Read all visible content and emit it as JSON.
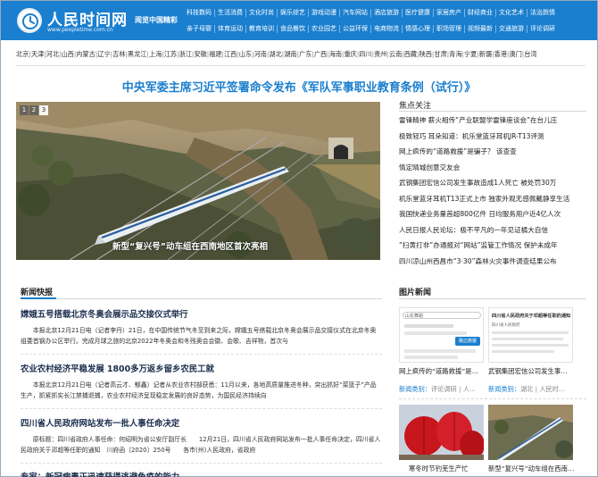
{
  "header": {
    "site_name": "人民时间网",
    "site_url": "www.peopletime.com.cn",
    "slogan": "阅览中国精彩",
    "nav_row1": [
      "科技数码",
      "生活消费",
      "文化时尚",
      "娱乐综艺",
      "游戏动漫",
      "汽车网站",
      "酒店旅游",
      "医疗健康",
      "家居房产",
      "财经商业",
      "文化艺术",
      "法治舆情"
    ],
    "nav_row2": [
      "亲子母婴",
      "体育运动",
      "教育培训",
      "食品餐饮",
      "农业园艺",
      "公益环保",
      "电商物流",
      "情感心理",
      "职场管理",
      "视频最新",
      "交通旅游",
      "评论调研"
    ]
  },
  "regions": [
    "北京",
    "天津",
    "河北",
    "山西",
    "内蒙古",
    "辽宁",
    "吉林",
    "黑龙江",
    "上海",
    "江苏",
    "浙江",
    "安徽",
    "福建",
    "江西",
    "山东",
    "河南",
    "湖北",
    "湖南",
    "广东",
    "广西",
    "海南",
    "重庆",
    "四川",
    "贵州",
    "云南",
    "西藏",
    "陕西",
    "甘肃",
    "青海",
    "宁夏",
    "新疆",
    "香港",
    "澳门",
    "台湾"
  ],
  "headline": "中央军委主席习近平签署命令发布《军队军事职业教育条例（试行）》",
  "slider": {
    "pages": [
      "1",
      "2",
      "3"
    ],
    "active_page": "3",
    "caption": "新型“复兴号”动车组在西南地区首次亮相"
  },
  "focus": {
    "title": "焦点关注",
    "items": [
      "雷锋精神 薪火相传“产业联盟学雷锋座谈会”在台儿庄",
      "极致轻巧 耳朵知道：机乐堂蓝牙耳机JR-T13评测",
      "网上疯传的“道路救援”是骗子？ 该查查",
      "情定晴城创意交友会",
      "武钢集团宏信公司发生事故造成1人死亡 被处罚30万",
      "机乐堂蓝牙耳机T13正式上市 独家外观无感佩戴静享生活",
      "我国快递业务量首超800亿件 日均服务用户近4亿人次",
      "人民日报人民论坛：极不平凡的一年见证橘大自信",
      "“扫黄打非”办通报对“网站”监管工作情况 保护未成年",
      "四川凉山州西昌市“3·30”森林火灾事件调查结果公布"
    ]
  },
  "news": {
    "title": "新闻快报",
    "items": [
      {
        "title": "嫦娥五号搭载北京冬奥会展示品交接仪式举行",
        "body": "本报北京12月21日电（记者李丹）21日，在中国传统节气冬至到来之际，嫦娥五号搭载北京冬奥会展示品交接仪式在北京冬奥组委首钢办公区举行。完成月球之旅的北京2022年冬奥会和冬残奥会会徽、会歌、吉祥物，首次与"
      },
      {
        "title": "农业农村经济平稳发展 1800多万返乡留乡农民工就",
        "body": "本报北京12月21日电（记者高云才、郁鑫）记者从农业农村部获悉：11月以来，各地高质量推进冬种，突出抓好“菜篮子”产品生产，抓紧抓实长江禁捕退捕，农业农村经济呈现稳定发展的良好态势，为国民经济持续向"
      },
      {
        "title": "四川省人民政府网站发布一批人事任命决定",
        "body": "原标题：四川省政府人事任命：何绍明为省公安厅副厅长　　12月21日，四川省人民政府网站发布一批人事任命决定，四川省人民政府关于邓超等任职的通知　川府函〔2020〕250号　　各市(州)人民政府，省政府"
      },
      {
        "title": "专家：新冠病毒正迅速获得逃避免疫的能力",
        "body": ""
      }
    ]
  },
  "pictures": {
    "title": "图片新闻",
    "items": [
      {
        "caption": "网上疯传的“道路救援”是…",
        "category": "新闻类别：",
        "category_value": "评论调研 | 人…"
      },
      {
        "caption": "武钢集团宏信公司发生事…",
        "category": "新闻类别：",
        "category_value": "湖北 | 人民时…"
      },
      {
        "caption": "寒冬时节钓芜生产忙",
        "category": "",
        "category_value": ""
      },
      {
        "caption": "新型“复兴号”动车组在西南…",
        "category": "",
        "category_value": ""
      }
    ],
    "screenshot_texts": {
      "doc_title": "四川省人民政府关于邓超等任职的通知",
      "phone_search": "山东舞蹈",
      "phone_btn": "路边救援",
      "small_text": "四川省人民政府"
    }
  },
  "colors": {
    "brand_blue": "#1a7fcf",
    "news_title": "#1a2d4d"
  }
}
